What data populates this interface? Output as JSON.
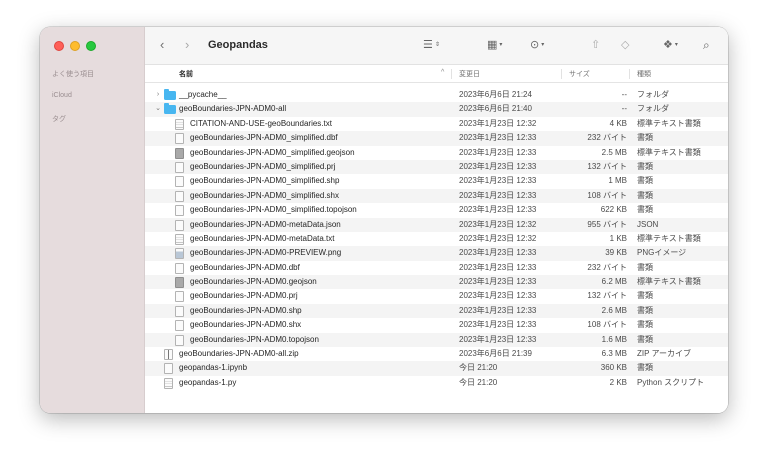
{
  "sidebar": {
    "favorites_heading": "よく使う項目",
    "icloud_heading": "iCloud",
    "tags_heading": "タグ"
  },
  "toolbar": {
    "back_glyph": "‹",
    "forward_glyph": "›",
    "title": "Geopandas"
  },
  "columns": {
    "name": "名前",
    "date": "変更日",
    "size": "サイズ",
    "kind": "種類"
  },
  "colors": {
    "folder": "#47b6f0",
    "sidebar_bg": "#e6dcdd",
    "close": "#fe5f57",
    "minimize": "#febc2e",
    "maximize": "#28c840"
  },
  "rows": [
    {
      "name": "__pycache__",
      "date": "2023年6月6日 21:24",
      "size": "--",
      "kind": "フォルダ",
      "level": 0,
      "icon": "folder",
      "disclosure": "›"
    },
    {
      "name": "geoBoundaries-JPN-ADM0-all",
      "date": "2023年6月6日 21:40",
      "size": "--",
      "kind": "フォルダ",
      "level": 0,
      "icon": "folder",
      "disclosure": "⌄"
    },
    {
      "name": "CITATION-AND-USE-geoBoundaries.txt",
      "date": "2023年1月23日 12:32",
      "size": "4 KB",
      "kind": "標準テキスト書類",
      "level": 1,
      "icon": "lines"
    },
    {
      "name": "geoBoundaries-JPN-ADM0_simplified.dbf",
      "date": "2023年1月23日 12:33",
      "size": "232 バイト",
      "kind": "書類",
      "level": 1,
      "icon": "doc"
    },
    {
      "name": "geoBoundaries-JPN-ADM0_simplified.geojson",
      "date": "2023年1月23日 12:33",
      "size": "2.5 MB",
      "kind": "標準テキスト書類",
      "level": 1,
      "icon": "dark"
    },
    {
      "name": "geoBoundaries-JPN-ADM0_simplified.prj",
      "date": "2023年1月23日 12:33",
      "size": "132 バイト",
      "kind": "書類",
      "level": 1,
      "icon": "doc"
    },
    {
      "name": "geoBoundaries-JPN-ADM0_simplified.shp",
      "date": "2023年1月23日 12:33",
      "size": "1 MB",
      "kind": "書類",
      "level": 1,
      "icon": "doc"
    },
    {
      "name": "geoBoundaries-JPN-ADM0_simplified.shx",
      "date": "2023年1月23日 12:33",
      "size": "108 バイト",
      "kind": "書類",
      "level": 1,
      "icon": "doc"
    },
    {
      "name": "geoBoundaries-JPN-ADM0_simplified.topojson",
      "date": "2023年1月23日 12:33",
      "size": "622 KB",
      "kind": "書類",
      "level": 1,
      "icon": "doc"
    },
    {
      "name": "geoBoundaries-JPN-ADM0-metaData.json",
      "date": "2023年1月23日 12:32",
      "size": "955 バイト",
      "kind": "JSON",
      "level": 1,
      "icon": "doc"
    },
    {
      "name": "geoBoundaries-JPN-ADM0-metaData.txt",
      "date": "2023年1月23日 12:32",
      "size": "1 KB",
      "kind": "標準テキスト書類",
      "level": 1,
      "icon": "lines"
    },
    {
      "name": "geoBoundaries-JPN-ADM0-PREVIEW.png",
      "date": "2023年1月23日 12:33",
      "size": "39 KB",
      "kind": "PNGイメージ",
      "level": 1,
      "icon": "img"
    },
    {
      "name": "geoBoundaries-JPN-ADM0.dbf",
      "date": "2023年1月23日 12:33",
      "size": "232 バイト",
      "kind": "書類",
      "level": 1,
      "icon": "doc"
    },
    {
      "name": "geoBoundaries-JPN-ADM0.geojson",
      "date": "2023年1月23日 12:33",
      "size": "6.2 MB",
      "kind": "標準テキスト書類",
      "level": 1,
      "icon": "dark"
    },
    {
      "name": "geoBoundaries-JPN-ADM0.prj",
      "date": "2023年1月23日 12:33",
      "size": "132 バイト",
      "kind": "書類",
      "level": 1,
      "icon": "doc"
    },
    {
      "name": "geoBoundaries-JPN-ADM0.shp",
      "date": "2023年1月23日 12:33",
      "size": "2.6 MB",
      "kind": "書類",
      "level": 1,
      "icon": "doc"
    },
    {
      "name": "geoBoundaries-JPN-ADM0.shx",
      "date": "2023年1月23日 12:33",
      "size": "108 バイト",
      "kind": "書類",
      "level": 1,
      "icon": "doc"
    },
    {
      "name": "geoBoundaries-JPN-ADM0.topojson",
      "date": "2023年1月23日 12:33",
      "size": "1.6 MB",
      "kind": "書類",
      "level": 1,
      "icon": "doc"
    },
    {
      "name": "geoBoundaries-JPN-ADM0-all.zip",
      "date": "2023年6月6日 21:39",
      "size": "6.3 MB",
      "kind": "ZIP アーカイブ",
      "level": 0,
      "icon": "zip"
    },
    {
      "name": "geopandas-1.ipynb",
      "date": "今日 21:20",
      "size": "360 KB",
      "kind": "書類",
      "level": 0,
      "icon": "doc"
    },
    {
      "name": "geopandas-1.py",
      "date": "今日 21:20",
      "size": "2 KB",
      "kind": "Python スクリプト",
      "level": 0,
      "icon": "lines"
    }
  ]
}
